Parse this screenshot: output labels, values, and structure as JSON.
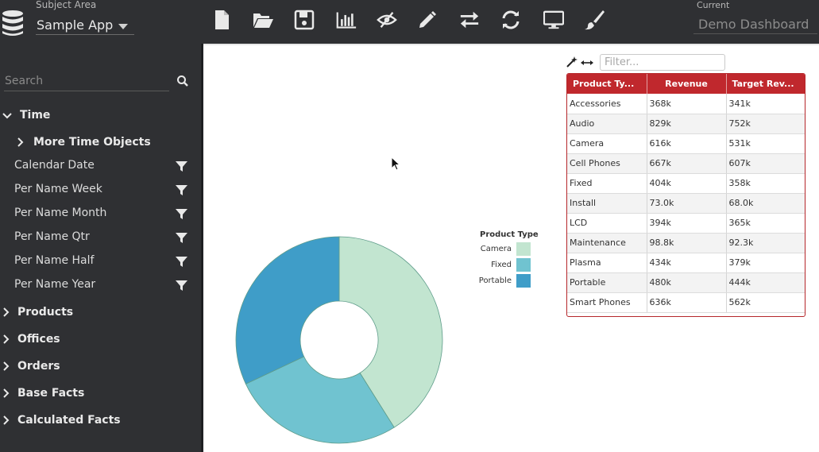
{
  "header": {
    "subject_area_caption": "Subject Area",
    "subject_area_value": "Sample App",
    "current_caption": "Current",
    "current_value": "Demo Dashboard",
    "toolbar": [
      {
        "name": "new-file-icon"
      },
      {
        "name": "open-folder-icon"
      },
      {
        "name": "save-icon"
      },
      {
        "name": "bar-chart-icon"
      },
      {
        "name": "hide-icon"
      },
      {
        "name": "edit-pencil-icon"
      },
      {
        "name": "swap-arrows-icon"
      },
      {
        "name": "refresh-icon"
      },
      {
        "name": "monitor-icon"
      },
      {
        "name": "paintbrush-icon"
      }
    ]
  },
  "sidebar": {
    "search_placeholder": "Search",
    "time_group": "Time",
    "more_time_objects": "More Time Objects",
    "time_fields": [
      "Calendar Date",
      "Per Name Week",
      "Per Name Month",
      "Per Name Qtr",
      "Per Name Half",
      "Per Name Year"
    ],
    "groups": [
      "Products",
      "Offices",
      "Orders",
      "Base Facts",
      "Calculated Facts"
    ]
  },
  "table": {
    "filter_placeholder": "Filter...",
    "headers": [
      "Product Ty...",
      "Revenue",
      "Target Rev..."
    ],
    "rows": [
      [
        "Accessories",
        "368k",
        "341k"
      ],
      [
        "Audio",
        "829k",
        "752k"
      ],
      [
        "Camera",
        "616k",
        "531k"
      ],
      [
        "Cell Phones",
        "667k",
        "607k"
      ],
      [
        "Fixed",
        "404k",
        "358k"
      ],
      [
        "Install",
        "73.0k",
        "68.0k"
      ],
      [
        "LCD",
        "394k",
        "365k"
      ],
      [
        "Maintenance",
        "98.8k",
        "92.3k"
      ],
      [
        "Plasma",
        "434k",
        "379k"
      ],
      [
        "Portable",
        "480k",
        "444k"
      ],
      [
        "Smart Phones",
        "636k",
        "562k"
      ]
    ]
  },
  "chart_data": {
    "type": "pie",
    "legend_title": "Product Type",
    "legend_position": "right",
    "categories": [
      "Camera",
      "Fixed",
      "Portable"
    ],
    "values": [
      616,
      404,
      480
    ],
    "colors": [
      "#c2e5d0",
      "#70c3d0",
      "#3f9dc8"
    ],
    "donut": true
  },
  "colors": {
    "topbar": "#2f3033",
    "sidebar": "#2f3033",
    "table_header": "#c0282d"
  }
}
